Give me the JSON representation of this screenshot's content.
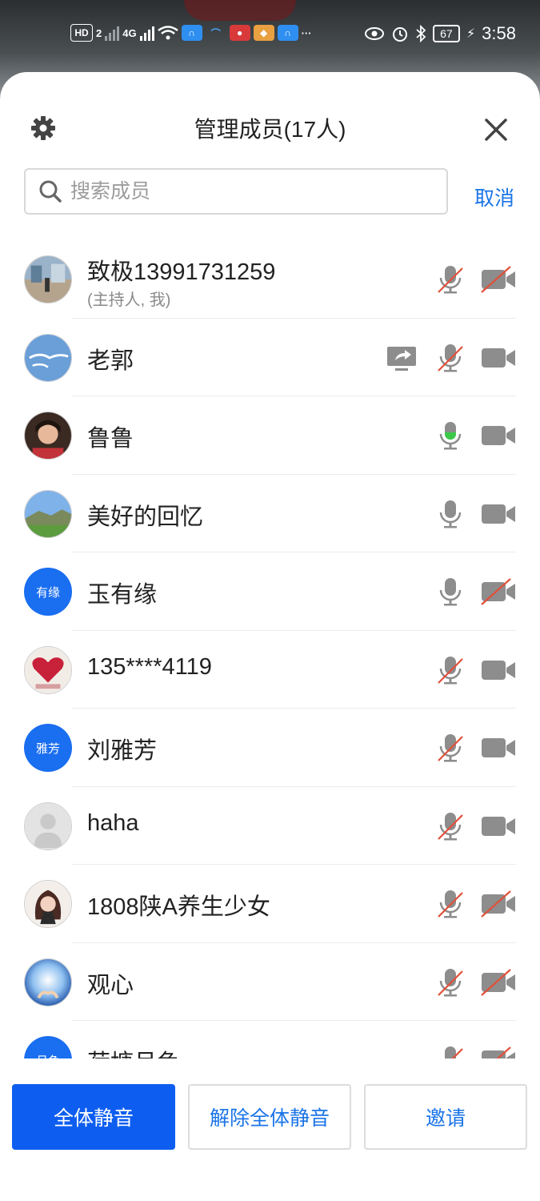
{
  "status_bar": {
    "left_labels": [
      "HD",
      "2",
      "4G"
    ],
    "battery": "67",
    "time": "3:58",
    "more": "···"
  },
  "sheet": {
    "title": "管理成员(17人)",
    "search": {
      "placeholder": "搜索成员",
      "value": ""
    },
    "cancel_label": "取消"
  },
  "members": [
    {
      "name": "致极13991731259",
      "sub": "(主持人, 我)",
      "avatar": "photo-street",
      "mic": "muted",
      "cam": "off",
      "sharing": false
    },
    {
      "name": "老郭",
      "avatar": "photo-birds",
      "mic": "muted",
      "cam": "on",
      "sharing": true
    },
    {
      "name": "鲁鲁",
      "avatar": "photo-portrait",
      "mic": "speaking",
      "cam": "on",
      "sharing": false
    },
    {
      "name": "美好的回忆",
      "avatar": "photo-landscape",
      "mic": "on",
      "cam": "on",
      "sharing": false
    },
    {
      "name": "玉有缘",
      "avatar_text": "有缘",
      "mic": "on",
      "cam": "off",
      "sharing": false
    },
    {
      "name": "135****4119",
      "avatar": "photo-heart",
      "mic": "muted",
      "cam": "on",
      "sharing": false
    },
    {
      "name": "刘雅芳",
      "avatar_text": "雅芳",
      "mic": "muted",
      "cam": "on",
      "sharing": false
    },
    {
      "name": "haha",
      "avatar": "default-person",
      "mic": "muted",
      "cam": "on",
      "sharing": false
    },
    {
      "name": "1808陕A养生少女",
      "avatar": "illustration-woman",
      "mic": "muted",
      "cam": "off",
      "sharing": false
    },
    {
      "name": "观心",
      "avatar": "photo-light",
      "mic": "muted",
      "cam": "off",
      "sharing": false
    },
    {
      "name": "荷塘月色",
      "avatar_text": "月色",
      "mic": "muted",
      "cam": "off",
      "sharing": false
    }
  ],
  "footer": {
    "mute_all": "全体静音",
    "unmute_all": "解除全体静音",
    "invite": "邀请"
  },
  "colors": {
    "accent": "#1a74e8",
    "primary_button": "#0d5ef0",
    "muted_slash": "#e0503a",
    "speaking": "#3cc84a",
    "icon_gray": "#8d8d8d"
  }
}
